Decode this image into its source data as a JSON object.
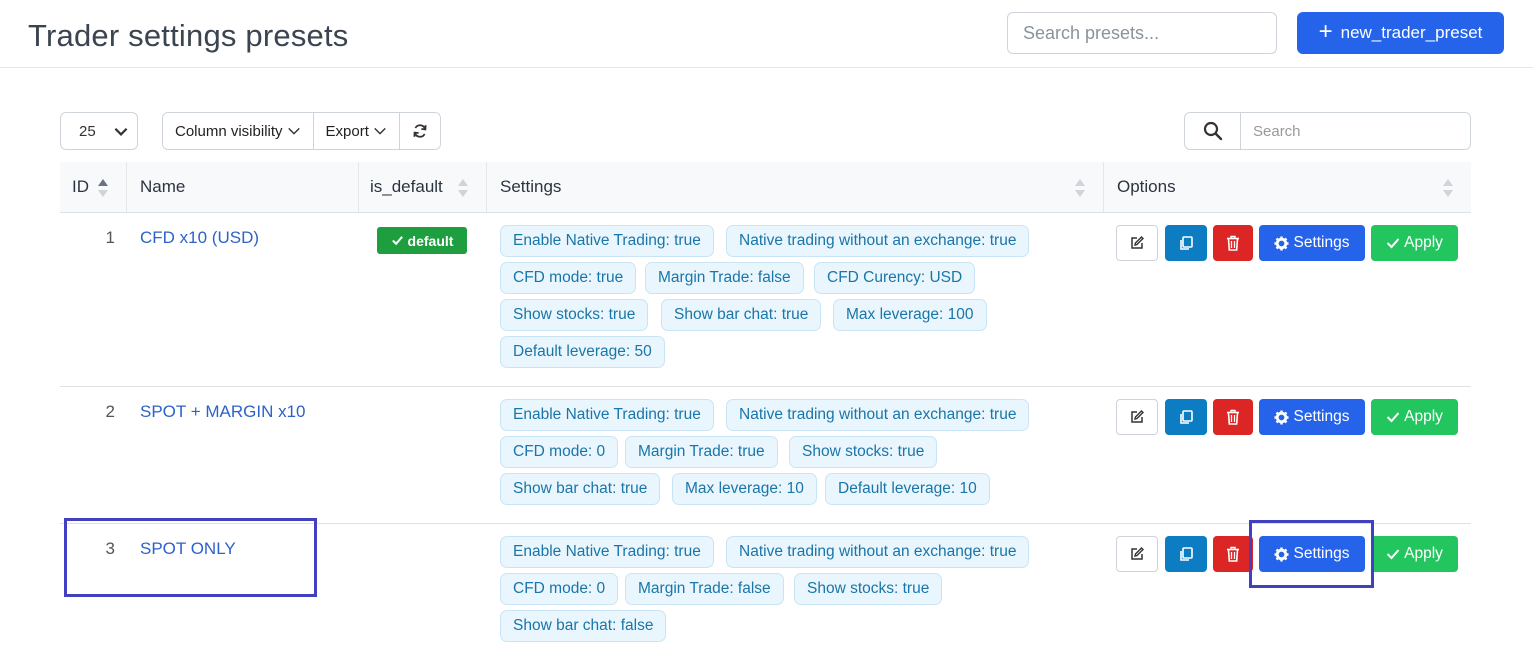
{
  "page": {
    "title": "Trader settings presets",
    "search_placeholder": "Search presets...",
    "new_button_label": "new_trader_preset"
  },
  "toolbar": {
    "page_length": "25",
    "column_visibility_label": "Column visibility",
    "export_label": "Export",
    "search_placeholder": "Search"
  },
  "table": {
    "columns": [
      "ID",
      "Name",
      "is_default",
      "Settings",
      "Options"
    ],
    "rows": [
      {
        "id": "1",
        "name": "CFD x10 (USD)",
        "default_badge": "default",
        "settings": [
          "Enable Native Trading: true",
          "Native trading without an exchange: true",
          "CFD mode: true",
          "Margin Trade: false",
          "CFD Curency: USD",
          "Show stocks: true",
          "Show bar chat: true",
          "Max leverage: 100",
          "Default leverage: 50"
        ]
      },
      {
        "id": "2",
        "name": "SPOT + MARGIN x10",
        "default_badge": "",
        "settings": [
          "Enable Native Trading: true",
          "Native trading without an exchange: true",
          "CFD mode: 0",
          "Margin Trade: true",
          "Show stocks: true",
          "Show bar chat: true",
          "Max leverage: 10",
          "Default leverage: 10"
        ]
      },
      {
        "id": "3",
        "name": "SPOT ONLY",
        "default_badge": "",
        "settings": [
          "Enable Native Trading: true",
          "Native trading without an exchange: true",
          "CFD mode: 0",
          "Margin Trade: false",
          "Show stocks: true",
          "Show bar chat: false"
        ]
      }
    ],
    "action_labels": {
      "settings": "Settings",
      "apply": "Apply"
    }
  },
  "colors": {
    "primary": "#2563eb",
    "success": "#22c55e",
    "danger": "#dc2626",
    "info": "#0c7dc2",
    "default_badge": "#1e9e3e",
    "highlight": "#4040c0"
  }
}
